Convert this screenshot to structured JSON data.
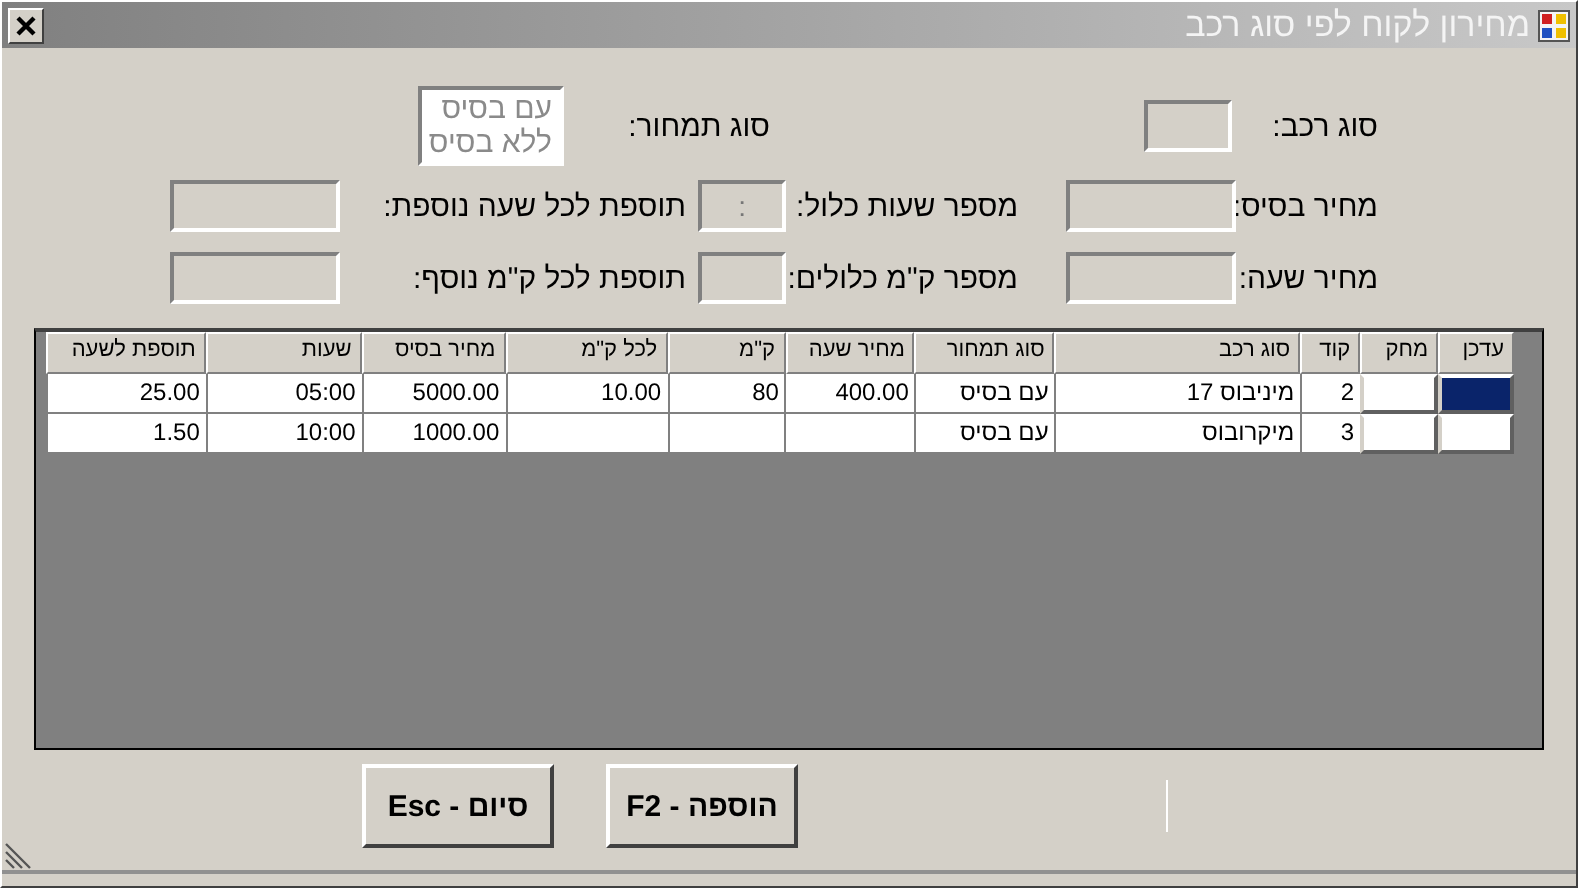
{
  "window": {
    "title": "מחירון לקוח לפי סוג רכב"
  },
  "form": {
    "vehicle_type": {
      "label": "סוג רכב:"
    },
    "pricing_type": {
      "label": "סוג תמחור:",
      "disabled": true,
      "options": [
        "עם בסיס",
        "ללא בסיס"
      ]
    },
    "rows": [
      [
        {
          "label": "מחיר בסיס:"
        },
        {
          "label": "מספר שעות כלול:",
          "value": ":"
        },
        {
          "label": "תוספת לכל שעה נוספת:"
        }
      ],
      [
        {
          "label": "מחיר שעה:"
        },
        {
          "label": "מספר ק\"מ כלולים:"
        },
        {
          "label": "תוספת לכל ק\"מ נוסף:"
        }
      ]
    ]
  },
  "table": {
    "columns": [
      "עדכן",
      "מחק",
      "קוד",
      "סוג רכב",
      "סוג תמחור",
      "מחיר שעה",
      "ק\"מ",
      "לכל ק\"מ",
      "מחיר בסיס",
      "שעות",
      "תוספת לשעה"
    ],
    "rows": [
      {
        "selected": true,
        "cells": [
          "",
          "",
          "2",
          "מיניבוס 17",
          "עם בסיס",
          "400.00",
          "80",
          "10.00",
          "5000.00",
          "05:00",
          "25.00"
        ]
      },
      {
        "selected": false,
        "cells": [
          "",
          "",
          "3",
          "מיקרובוס",
          "עם בסיס",
          "",
          "",
          "",
          "1000.00",
          "10:00",
          "1.50"
        ]
      }
    ]
  },
  "buttons": [
    "הוספה - F2",
    "סיום - Esc"
  ]
}
